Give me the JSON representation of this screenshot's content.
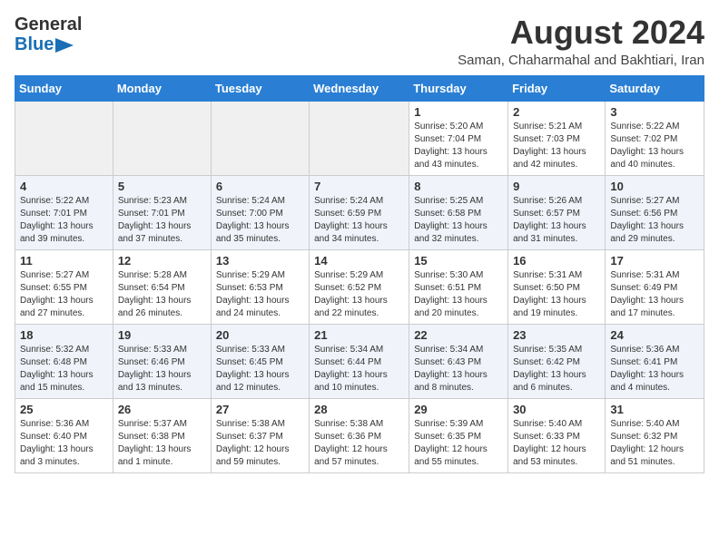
{
  "header": {
    "logo_line1": "General",
    "logo_line2": "Blue",
    "month_year": "August 2024",
    "location": "Saman, Chaharmahal and Bakhtiari, Iran"
  },
  "weekdays": [
    "Sunday",
    "Monday",
    "Tuesday",
    "Wednesday",
    "Thursday",
    "Friday",
    "Saturday"
  ],
  "weeks": [
    [
      {
        "day": "",
        "info": ""
      },
      {
        "day": "",
        "info": ""
      },
      {
        "day": "",
        "info": ""
      },
      {
        "day": "",
        "info": ""
      },
      {
        "day": "1",
        "info": "Sunrise: 5:20 AM\nSunset: 7:04 PM\nDaylight: 13 hours\nand 43 minutes."
      },
      {
        "day": "2",
        "info": "Sunrise: 5:21 AM\nSunset: 7:03 PM\nDaylight: 13 hours\nand 42 minutes."
      },
      {
        "day": "3",
        "info": "Sunrise: 5:22 AM\nSunset: 7:02 PM\nDaylight: 13 hours\nand 40 minutes."
      }
    ],
    [
      {
        "day": "4",
        "info": "Sunrise: 5:22 AM\nSunset: 7:01 PM\nDaylight: 13 hours\nand 39 minutes."
      },
      {
        "day": "5",
        "info": "Sunrise: 5:23 AM\nSunset: 7:01 PM\nDaylight: 13 hours\nand 37 minutes."
      },
      {
        "day": "6",
        "info": "Sunrise: 5:24 AM\nSunset: 7:00 PM\nDaylight: 13 hours\nand 35 minutes."
      },
      {
        "day": "7",
        "info": "Sunrise: 5:24 AM\nSunset: 6:59 PM\nDaylight: 13 hours\nand 34 minutes."
      },
      {
        "day": "8",
        "info": "Sunrise: 5:25 AM\nSunset: 6:58 PM\nDaylight: 13 hours\nand 32 minutes."
      },
      {
        "day": "9",
        "info": "Sunrise: 5:26 AM\nSunset: 6:57 PM\nDaylight: 13 hours\nand 31 minutes."
      },
      {
        "day": "10",
        "info": "Sunrise: 5:27 AM\nSunset: 6:56 PM\nDaylight: 13 hours\nand 29 minutes."
      }
    ],
    [
      {
        "day": "11",
        "info": "Sunrise: 5:27 AM\nSunset: 6:55 PM\nDaylight: 13 hours\nand 27 minutes."
      },
      {
        "day": "12",
        "info": "Sunrise: 5:28 AM\nSunset: 6:54 PM\nDaylight: 13 hours\nand 26 minutes."
      },
      {
        "day": "13",
        "info": "Sunrise: 5:29 AM\nSunset: 6:53 PM\nDaylight: 13 hours\nand 24 minutes."
      },
      {
        "day": "14",
        "info": "Sunrise: 5:29 AM\nSunset: 6:52 PM\nDaylight: 13 hours\nand 22 minutes."
      },
      {
        "day": "15",
        "info": "Sunrise: 5:30 AM\nSunset: 6:51 PM\nDaylight: 13 hours\nand 20 minutes."
      },
      {
        "day": "16",
        "info": "Sunrise: 5:31 AM\nSunset: 6:50 PM\nDaylight: 13 hours\nand 19 minutes."
      },
      {
        "day": "17",
        "info": "Sunrise: 5:31 AM\nSunset: 6:49 PM\nDaylight: 13 hours\nand 17 minutes."
      }
    ],
    [
      {
        "day": "18",
        "info": "Sunrise: 5:32 AM\nSunset: 6:48 PM\nDaylight: 13 hours\nand 15 minutes."
      },
      {
        "day": "19",
        "info": "Sunrise: 5:33 AM\nSunset: 6:46 PM\nDaylight: 13 hours\nand 13 minutes."
      },
      {
        "day": "20",
        "info": "Sunrise: 5:33 AM\nSunset: 6:45 PM\nDaylight: 13 hours\nand 12 minutes."
      },
      {
        "day": "21",
        "info": "Sunrise: 5:34 AM\nSunset: 6:44 PM\nDaylight: 13 hours\nand 10 minutes."
      },
      {
        "day": "22",
        "info": "Sunrise: 5:34 AM\nSunset: 6:43 PM\nDaylight: 13 hours\nand 8 minutes."
      },
      {
        "day": "23",
        "info": "Sunrise: 5:35 AM\nSunset: 6:42 PM\nDaylight: 13 hours\nand 6 minutes."
      },
      {
        "day": "24",
        "info": "Sunrise: 5:36 AM\nSunset: 6:41 PM\nDaylight: 13 hours\nand 4 minutes."
      }
    ],
    [
      {
        "day": "25",
        "info": "Sunrise: 5:36 AM\nSunset: 6:40 PM\nDaylight: 13 hours\nand 3 minutes."
      },
      {
        "day": "26",
        "info": "Sunrise: 5:37 AM\nSunset: 6:38 PM\nDaylight: 13 hours\nand 1 minute."
      },
      {
        "day": "27",
        "info": "Sunrise: 5:38 AM\nSunset: 6:37 PM\nDaylight: 12 hours\nand 59 minutes."
      },
      {
        "day": "28",
        "info": "Sunrise: 5:38 AM\nSunset: 6:36 PM\nDaylight: 12 hours\nand 57 minutes."
      },
      {
        "day": "29",
        "info": "Sunrise: 5:39 AM\nSunset: 6:35 PM\nDaylight: 12 hours\nand 55 minutes."
      },
      {
        "day": "30",
        "info": "Sunrise: 5:40 AM\nSunset: 6:33 PM\nDaylight: 12 hours\nand 53 minutes."
      },
      {
        "day": "31",
        "info": "Sunrise: 5:40 AM\nSunset: 6:32 PM\nDaylight: 12 hours\nand 51 minutes."
      }
    ]
  ]
}
